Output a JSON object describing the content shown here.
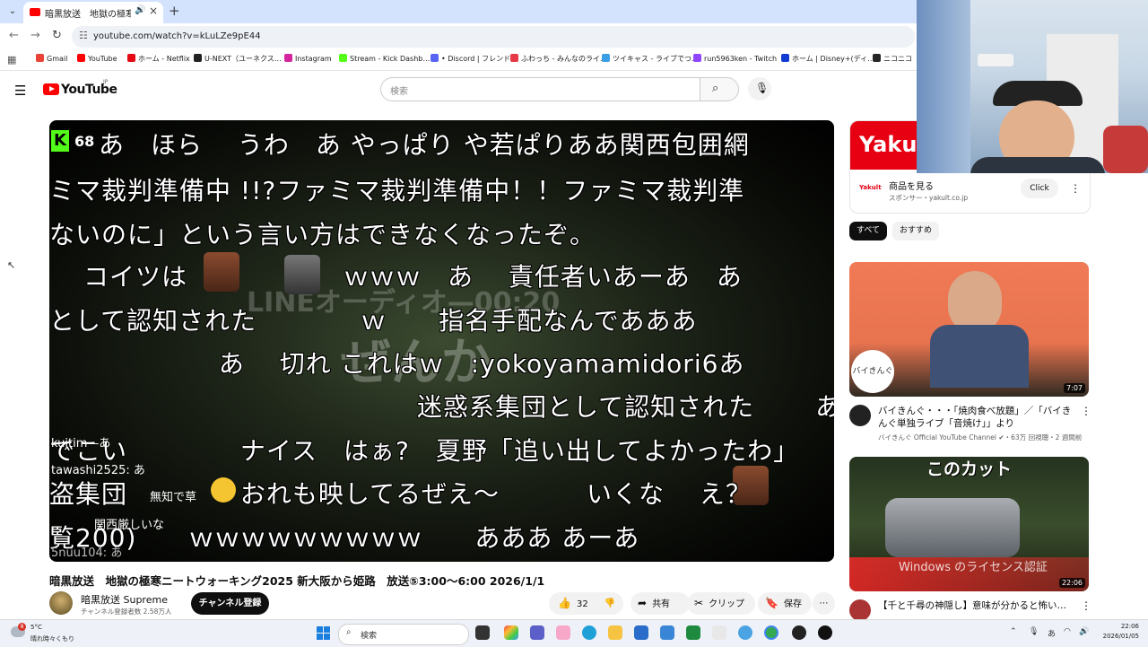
{
  "browser": {
    "tab_title": "暗黒放送　地獄の極寒ニート",
    "url": "youtube.com/watch?v=kLuLZe9pE44",
    "bookmarks": [
      {
        "label": "Gmail",
        "color": "#ea4335"
      },
      {
        "label": "YouTube",
        "color": "#ff0000"
      },
      {
        "label": "ホーム - Netflix",
        "color": "#e50914"
      },
      {
        "label": "U-NEXT（ユーネクス…",
        "color": "#222222"
      },
      {
        "label": "Instagram",
        "color": "#d6249f"
      },
      {
        "label": "Stream - Kick Dashb…",
        "color": "#53fc18"
      },
      {
        "label": "• Discord | フレンド",
        "color": "#5865f2"
      },
      {
        "label": "ふわっち - みんなのライ…",
        "color": "#e63946"
      },
      {
        "label": "ツイキャス - ライブでつ…",
        "color": "#3b9fe6"
      },
      {
        "label": "run5963ken - Twitch",
        "color": "#9146ff"
      },
      {
        "label": "ホーム | Disney+(ディ…",
        "color": "#113ccf"
      },
      {
        "label": "ニコニコ",
        "color": "#252525"
      }
    ]
  },
  "youtube": {
    "logo_text": "YouTube",
    "region": "JP",
    "search_placeholder": "検索"
  },
  "video": {
    "live_count": "68",
    "overlay_lines": [
      "あ　ほら　 うわ　あ やっぱり や若ぱりああ関西包囲網",
      "ミマ裁判準備中 !!?ファミマ裁判準備中！！ファミマ裁判準",
      "ないのに」という言い方はできなくなったぞ。",
      "コイツは　　　　　　ｗｗｗ　あ　 責任者いあーあ　あ",
      "として認知された　　　　ｗ　　指名手配なんであああ",
      "　 あ　 切れ これはｗ　:yokoyamamidori6あ",
      "　　　　　迷惑系集団として認知された　　 あ",
      "でこい　　　　 ナイス　はぁ?　夏野「追い出してよかったわ」",
      "盗集団　　　　 おれも映してるぜえ〜　　　 いくな　 え？",
      "覧200)　　ｗｗｗｗｗｗｗｗｗ　　あああ あーあ"
    ],
    "bg_text_line": "LINEオーディオ—00:20",
    "bg_text_big": "ぜんか",
    "small_comments": [
      "kujtim—あ",
      "tawashi2525: あ",
      "無知で草",
      "関西厳しいな",
      "5nuu104: あ"
    ],
    "title": "暗黒放送　地獄の極寒ニートウォーキング2025 新大阪から姫路　放送⑤3:00〜6:00 2026/1/1"
  },
  "channel": {
    "name": "暗黒放送 Supreme",
    "subscribers": "チャンネル登録者数 2.58万人",
    "subscribe_label": "チャンネル登録"
  },
  "actions": {
    "like_count": "32",
    "share_label": "共有",
    "clip_label": "クリップ",
    "save_label": "保存"
  },
  "sidebar": {
    "ad": {
      "banner_text": "Yakult",
      "logo_text": "Yakult",
      "title": "商品を見る",
      "sponsor": "スポンサー・yakult.co.jp",
      "cta": "Click"
    },
    "chips": [
      "すべて",
      "おすすめ"
    ],
    "recommendations": [
      {
        "title": "バイきんぐ・・・「焼肉食べ放題」／「バイきんぐ単独ライブ「音焼け」」より",
        "channel": "バイきんぐ Official YouTube Channel",
        "meta": "・63万 回視聴・2 週間前",
        "duration": "7:07",
        "thumb_text": "バイきんぐ"
      },
      {
        "title": "【千と千尋の神隠し】意味が分かると怖い…",
        "channel": "",
        "meta": "",
        "duration": "22:06",
        "thumb_text": "このカット"
      }
    ],
    "activation_watermark": "Windows のライセンス認証"
  },
  "taskbar": {
    "notification_count": "8",
    "temperature": "5°C",
    "weather": "晴れ時々くもり",
    "search_placeholder": "検索",
    "time": "22:06",
    "date": "2026/01/05",
    "ime_label": "あ"
  }
}
